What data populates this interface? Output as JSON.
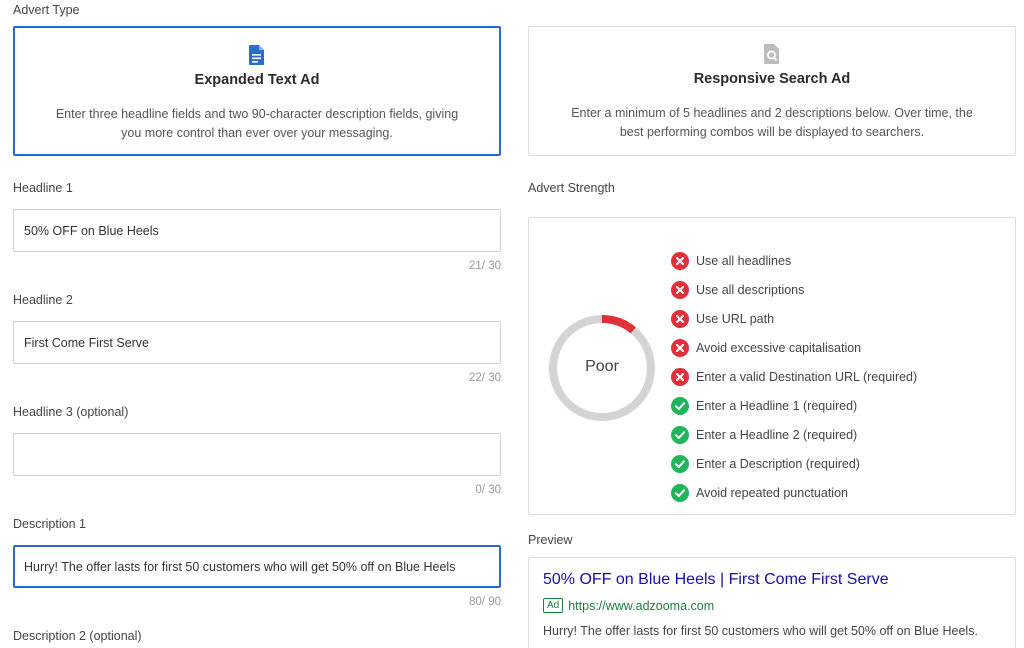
{
  "advert_type": {
    "label": "Advert Type",
    "options": [
      {
        "title": "Expanded Text Ad",
        "description": "Enter three headline fields and two 90-character description fields, giving you more control than ever over your messaging.",
        "icon": "document-icon",
        "selected": true
      },
      {
        "title": "Responsive Search Ad",
        "description": "Enter a minimum of 5 headlines and 2 descriptions below. Over time, the best performing combos will be displayed to searchers.",
        "icon": "search-document-icon",
        "selected": false
      }
    ]
  },
  "fields": {
    "headline1": {
      "label": "Headline 1",
      "value": "50% OFF on Blue Heels",
      "count": "21/ 30"
    },
    "headline2": {
      "label": "Headline 2",
      "value": "First Come First Serve",
      "count": "22/ 30"
    },
    "headline3": {
      "label": "Headline 3 (optional)",
      "value": "",
      "count": "0/ 30"
    },
    "description1": {
      "label": "Description 1",
      "value": "Hurry! The offer lasts for first 50 customers who will get 50% off on Blue Heels",
      "count": "80/ 90"
    },
    "description2": {
      "label": "Description 2 (optional)"
    }
  },
  "advert_strength": {
    "label": "Advert Strength",
    "rating": "Poor",
    "level": 0.11,
    "colors": {
      "track": "#d4d4d4",
      "fill": "#e0303a",
      "pass": "#22b45a",
      "fail": "#e0303a"
    },
    "checks": [
      {
        "text": "Use all headlines",
        "status": "fail"
      },
      {
        "text": "Use all descriptions",
        "status": "fail"
      },
      {
        "text": "Use URL path",
        "status": "fail"
      },
      {
        "text": "Avoid excessive capitalisation",
        "status": "fail"
      },
      {
        "text": "Enter a valid Destination URL (required)",
        "status": "fail"
      },
      {
        "text": "Enter a Headline 1 (required)",
        "status": "pass"
      },
      {
        "text": "Enter a Headline 2 (required)",
        "status": "pass"
      },
      {
        "text": "Enter a Description (required)",
        "status": "pass"
      },
      {
        "text": "Avoid repeated punctuation",
        "status": "pass"
      }
    ]
  },
  "preview": {
    "label": "Preview",
    "headline": "50% OFF on Blue Heels | First Come First Serve",
    "badge": "Ad",
    "url": "https://www.adzooma.com",
    "description": "Hurry! The offer lasts for first 50 customers who will get 50% off on Blue Heels."
  }
}
